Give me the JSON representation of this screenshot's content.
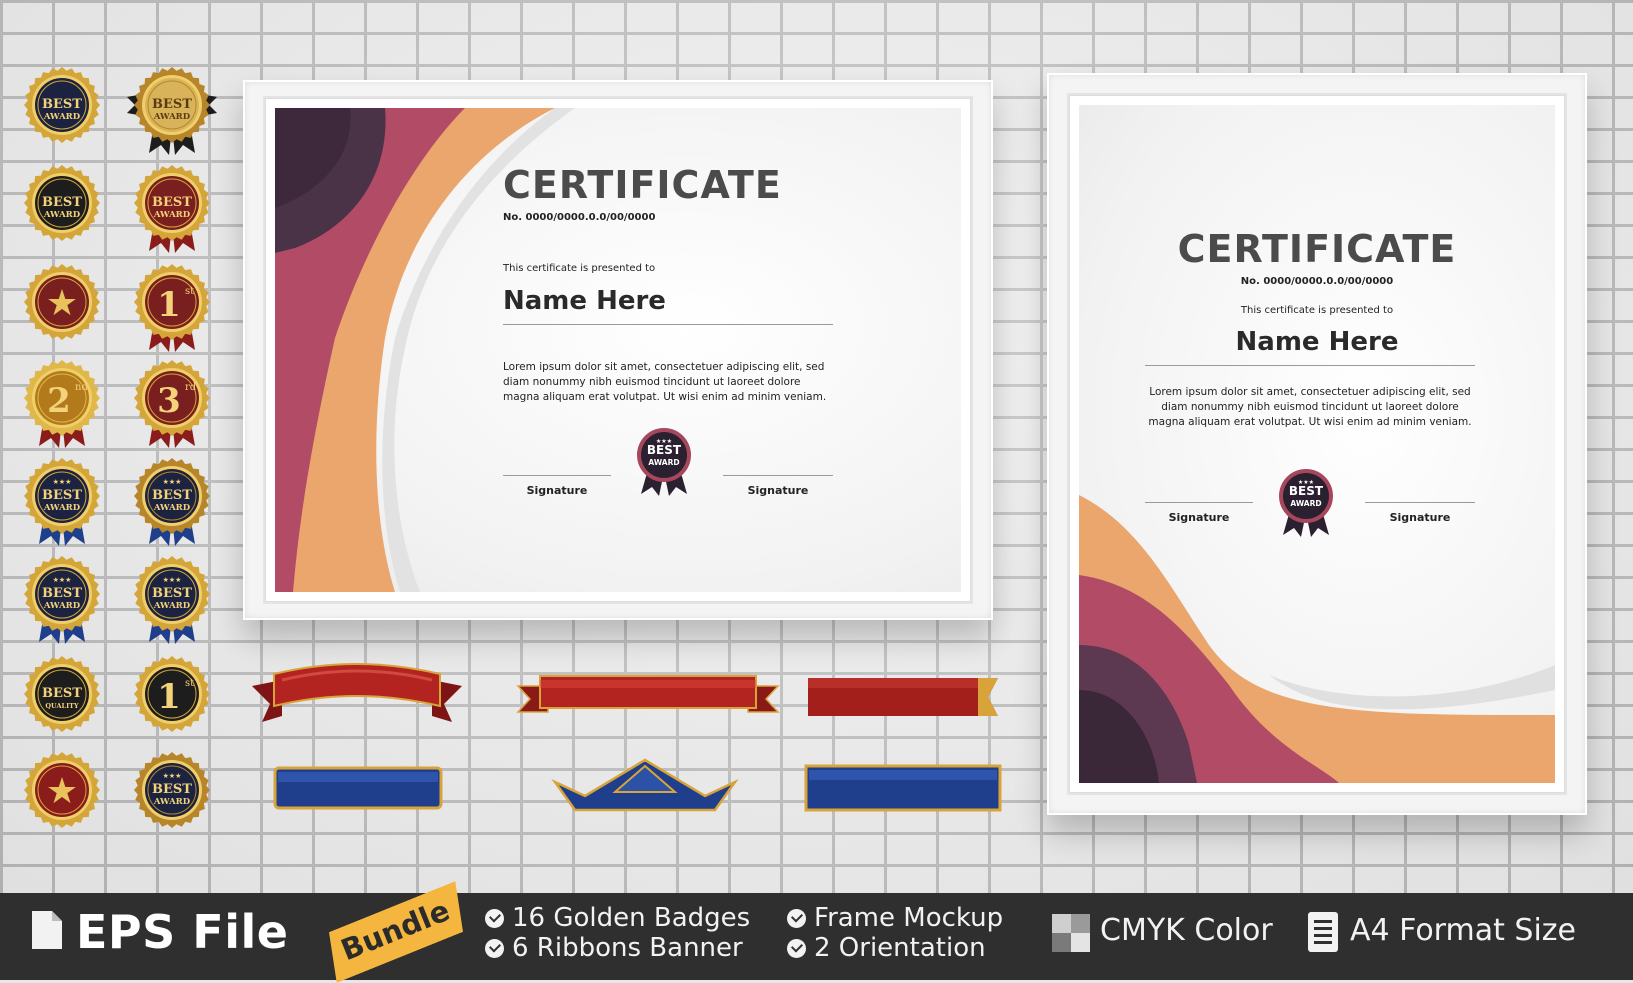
{
  "certificate_landscape": {
    "title": "CERTIFICATE",
    "number": "No. 0000/0000.0.0/00/0000",
    "presented": "This certificate is presented to",
    "name": "Name Here",
    "lorem": "Lorem ipsum dolor sit amet, consectetuer adipiscing elit, sed diam nonummy nibh euismod tincidunt ut laoreet dolore magna aliquam erat volutpat. Ut wisi enim ad minim veniam.",
    "signature_left": "Signature",
    "signature_right": "Signature",
    "seal_top": "BEST",
    "seal_bottom": "AWARD"
  },
  "certificate_portrait": {
    "title": "CERTIFICATE",
    "number": "No. 0000/0000.0.0/00/0000",
    "presented": "This certificate is presented to",
    "name": "Name Here",
    "lorem": "Lorem ipsum dolor sit amet, consectetuer adipiscing elit, sed diam nonummy nibh euismod tincidunt ut laoreet dolore magna aliquam erat volutpat. Ut wisi enim ad minim veniam.",
    "signature_left": "Signature",
    "signature_right": "Signature",
    "seal_top": "BEST",
    "seal_bottom": "AWARD"
  },
  "badges": [
    {
      "top": "BEST",
      "bottom": "AWARD",
      "style": "navy"
    },
    {
      "top": "BEST",
      "bottom": "AWARD",
      "style": "gold-ribbon"
    },
    {
      "top": "BEST",
      "bottom": "AWARD",
      "style": "black"
    },
    {
      "top": "BEST",
      "bottom": "AWARD",
      "style": "maroon"
    },
    {
      "top": "★",
      "bottom": "",
      "style": "star-gold"
    },
    {
      "top": "1",
      "sup": "st",
      "bottom": "",
      "style": "maroon-rank"
    },
    {
      "top": "2",
      "sup": "nd",
      "bottom": "",
      "style": "gold-rank"
    },
    {
      "top": "3",
      "sup": "rd",
      "bottom": "",
      "style": "maroon-rank"
    },
    {
      "top": "BEST",
      "bottom": "AWARD",
      "style": "navy-stars"
    },
    {
      "top": "BEST",
      "bottom": "AWARD",
      "style": "maroon-stars"
    },
    {
      "top": "BEST",
      "bottom": "AWARD",
      "style": "navy-stars"
    },
    {
      "top": "BEST",
      "bottom": "AWARD",
      "style": "navy-stars"
    },
    {
      "top": "BEST",
      "bottom": "QUALITY",
      "style": "black"
    },
    {
      "top": "1",
      "sup": "st",
      "bottom": "",
      "style": "black-rank"
    },
    {
      "top": "★",
      "bottom": "",
      "style": "star-maroon"
    },
    {
      "top": "BEST",
      "bottom": "AWARD",
      "style": "navy-laurel"
    }
  ],
  "footer": {
    "file_label": "EPS File",
    "bundle_label": "Bundle",
    "features": [
      "16 Golden Badges",
      "6  Ribbons Banner",
      "Frame Mockup",
      "2 Orientation"
    ],
    "cmyk_label": "CMYK Color",
    "format_label": "A4 Format Size"
  },
  "colors": {
    "plum": "#4a3347",
    "rose": "#b24b66",
    "peach": "#eba66d",
    "gold": "#d4a63a",
    "ribbon_red": "#b3231f",
    "ribbon_blue": "#1f3f8c",
    "bar": "#2f2f2f",
    "bundle": "#f4b63e"
  }
}
